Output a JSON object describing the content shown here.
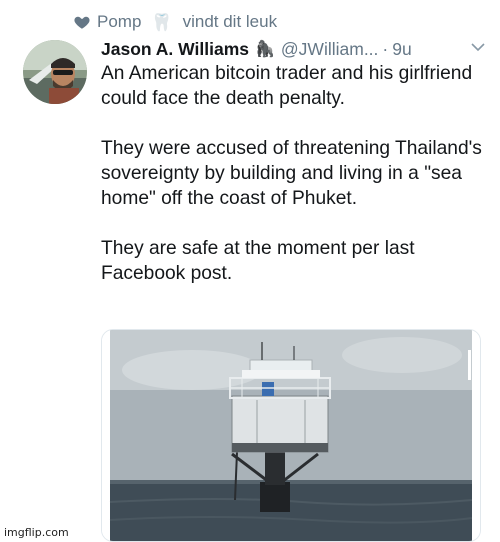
{
  "context": {
    "liker": "Pomp",
    "action": "vindt dit leuk",
    "icon": "heart-icon",
    "emoji": "🦷"
  },
  "tweet": {
    "author_name": "Jason A. Williams",
    "author_emoji": "🦍",
    "handle": "@JWilliam...",
    "separator": "·",
    "time": "9u",
    "paragraphs": [
      "An American bitcoin trader and his girlfriend could face the death penalty.",
      "They were accused of threatening Thailand's sovereignty by building and living in a \"sea home\" off the coast of Phuket.",
      "They are safe at the moment per last Facebook post."
    ]
  },
  "watermark": "imgflip.com",
  "colors": {
    "text": "#14171a",
    "secondary": "#657786",
    "border": "#e1e8ed"
  }
}
